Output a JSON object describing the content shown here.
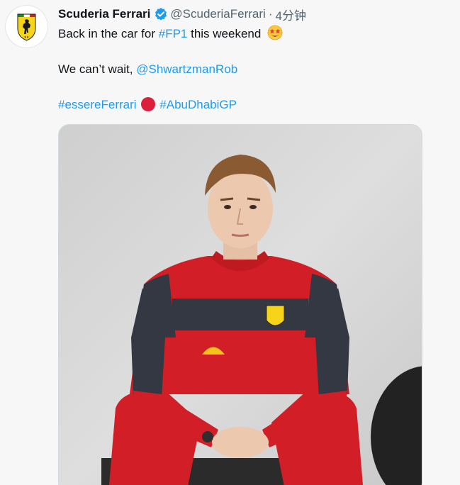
{
  "tweet": {
    "author_name": "Scuderia Ferrari",
    "verified": true,
    "handle": "@ScuderiaFerrari",
    "separator": "·",
    "time": "4分钟",
    "line1_text": "Back in the car for ",
    "line1_hashtag": "#FP1",
    "line1_suffix": " this weekend",
    "line1_emoji": "star-struck-emoji",
    "line2_text": "We can’t wait, ",
    "line2_mention": "@ShwartzmanRob",
    "line3_hashtag1": "#essereFerrari",
    "line3_flag": "red-circle-emoji",
    "line3_hashtag2": "#AbuDhabiGP"
  },
  "colors": {
    "link": "#1d9bf0",
    "verified_badge": "#1d9bf0",
    "ferrari_yellow": "#f5d41a",
    "suit_red": "#d21f27"
  },
  "icons": {
    "avatar": "ferrari-logo",
    "badge": "verified-badge-icon"
  },
  "media": {
    "alt": "driver-photo"
  }
}
